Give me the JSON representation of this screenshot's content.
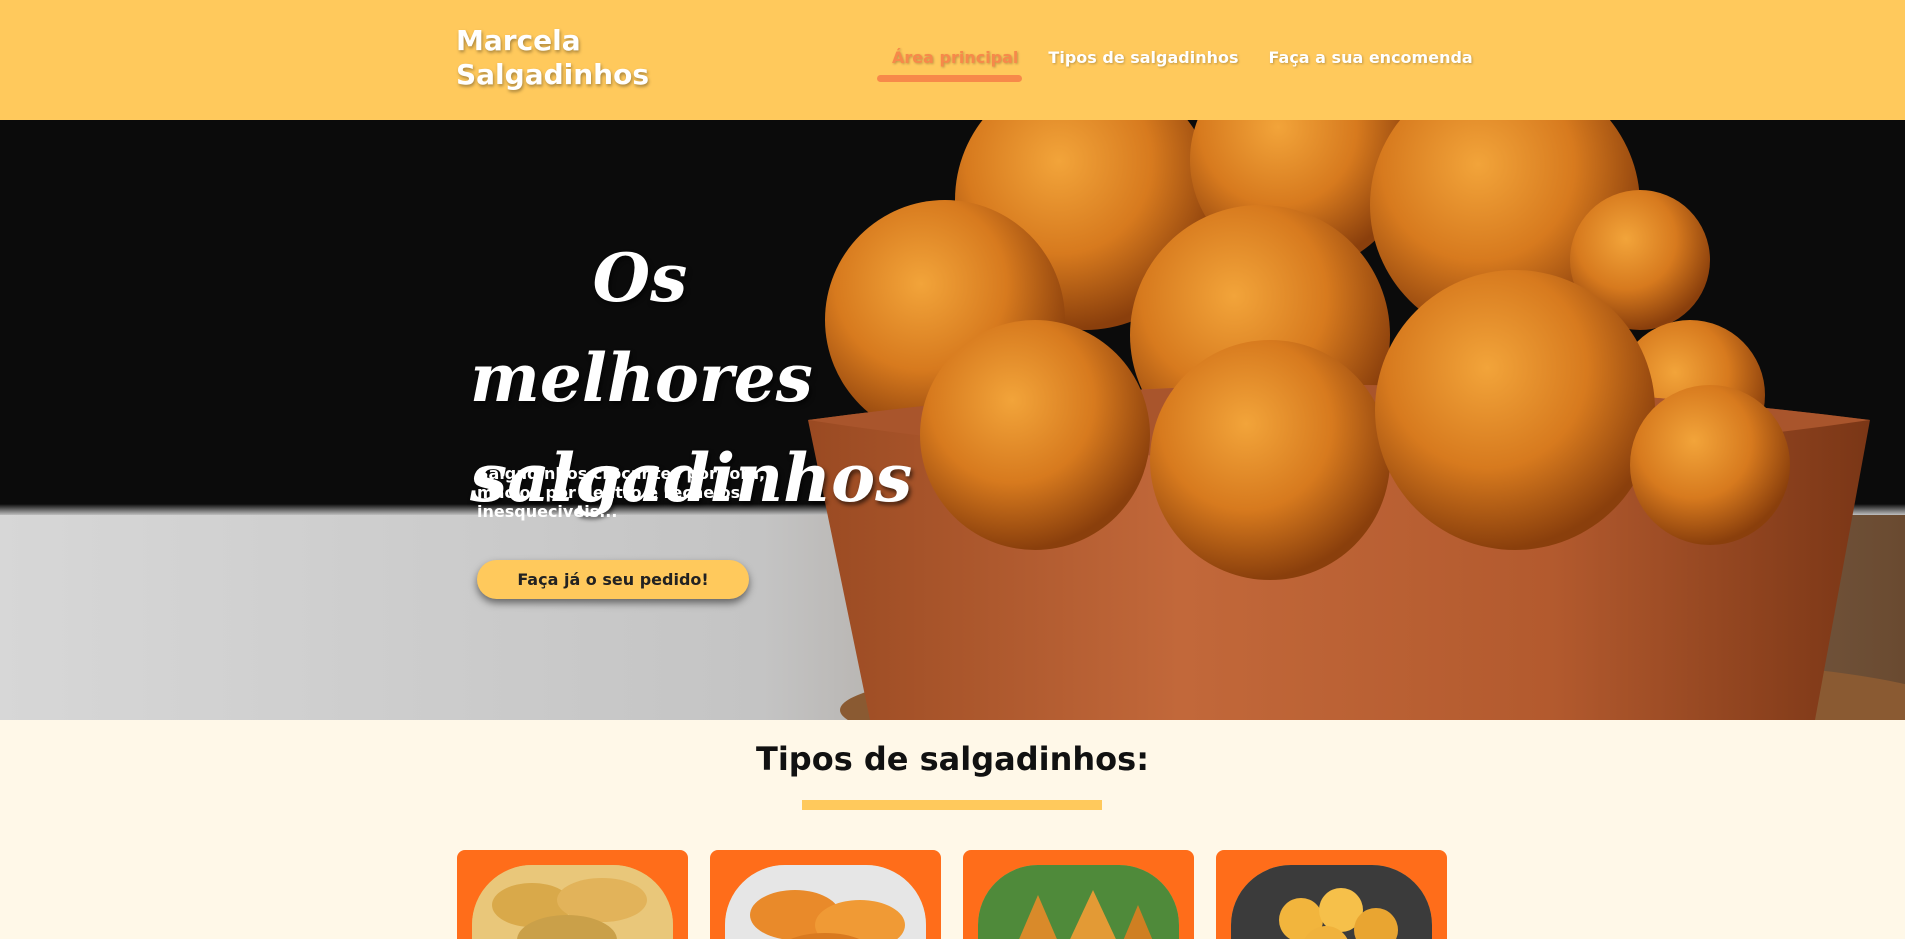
{
  "header": {
    "logo_line1": "Marcela",
    "logo_line2": "Salgadinhos",
    "nav": [
      {
        "label": "Área principal",
        "active": true
      },
      {
        "label": "Tipos de salgadinhos",
        "active": false
      },
      {
        "label": "Faça a sua encomenda",
        "active": false
      }
    ]
  },
  "hero": {
    "title_line1": "Os melhores",
    "title_line2": "salgadinhos",
    "subtitle": "Salgadinhos crocantes por fora, macios por dentro e recheios inesqueciveis...",
    "button": "Faça já o seu pedido!"
  },
  "types": {
    "title": "Tipos de salgadinhos:",
    "cards": [
      {
        "icon": "pastel-photo"
      },
      {
        "icon": "risoles-photo"
      },
      {
        "icon": "coxinha-photo"
      },
      {
        "icon": "bolinha-photo"
      }
    ]
  },
  "colors": {
    "header_bg": "#ffc95c",
    "accent_orange": "#f7894a",
    "card_bg": "#ff6d1a",
    "section_bg": "#fff8e8"
  }
}
